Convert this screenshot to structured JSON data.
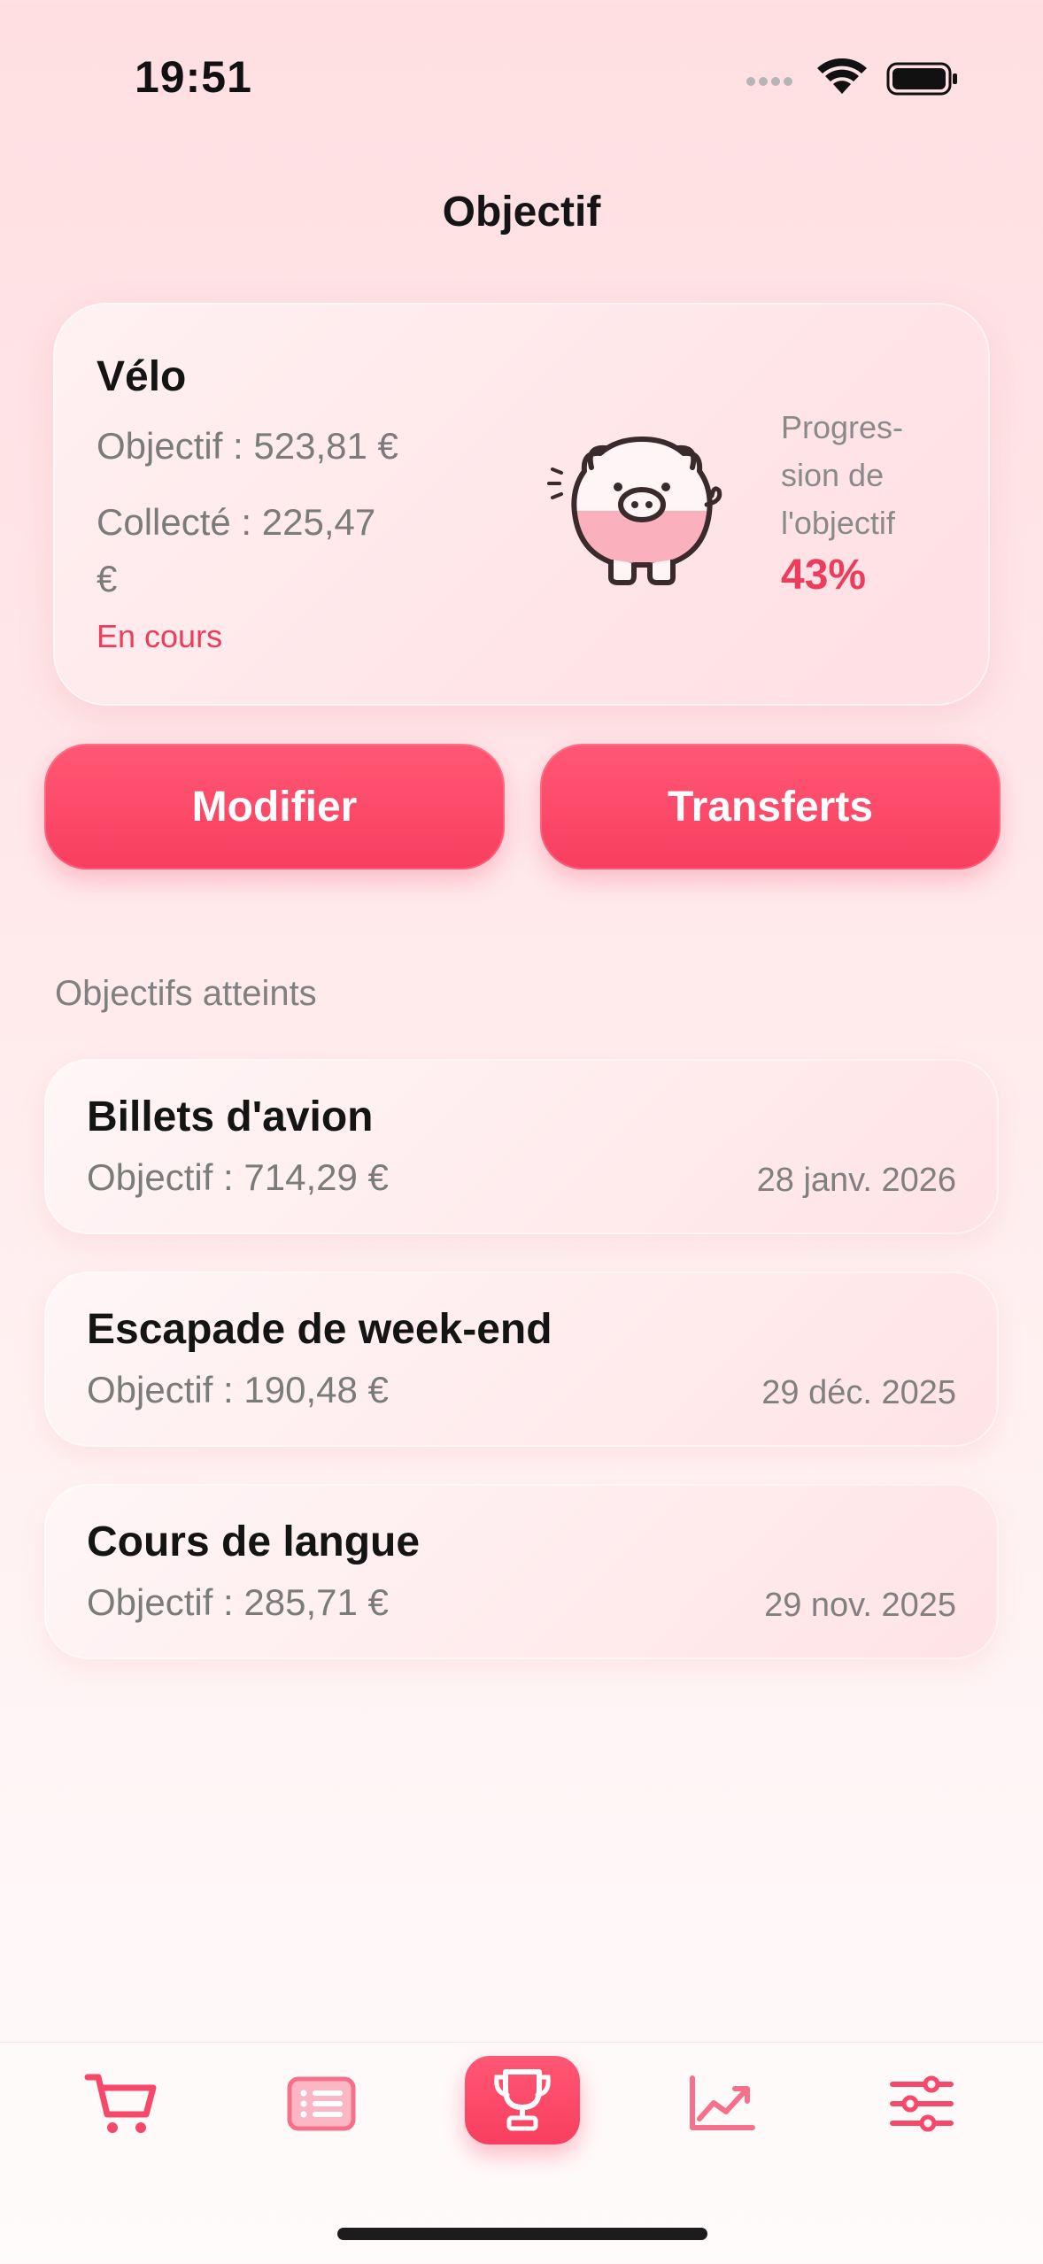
{
  "status_bar": {
    "time": "19:51"
  },
  "nav": {
    "title": "Objectif"
  },
  "current_goal": {
    "name": "Vélo",
    "target_text": "Objectif : 523,81 €",
    "collected_text": "Collecté : 225,47 €",
    "status": "En cours",
    "progress_label": "Progres-sion de l'objectif",
    "progress_value_text": "43%",
    "progress_fraction": 0.43
  },
  "buttons": {
    "modify": "Modifier",
    "transfers": "Transferts"
  },
  "achieved": {
    "title": "Objectifs atteints",
    "items": [
      {
        "name": "Billets d'avion",
        "target": "Objectif : 714,29 €",
        "date": "28 janv. 2026"
      },
      {
        "name": "Escapade de week-end",
        "target": "Objectif : 190,48 €",
        "date": "29 déc. 2025"
      },
      {
        "name": "Cours de langue",
        "target": "Objectif : 285,71 €",
        "date": "29 nov. 2025"
      }
    ]
  },
  "tabbar": {
    "tabs": [
      {
        "icon": "cart-icon",
        "selected": false
      },
      {
        "icon": "list-icon",
        "selected": false
      },
      {
        "icon": "trophy-icon",
        "selected": true
      },
      {
        "icon": "chart-icon",
        "selected": false
      },
      {
        "icon": "settings-icon",
        "selected": false
      }
    ]
  },
  "colors": {
    "accent": "#f93e60",
    "accent_light": "#ff5874",
    "pig_fill": "#fbb0bd",
    "text_primary": "#141414",
    "text_secondary": "#7b7b7b"
  }
}
